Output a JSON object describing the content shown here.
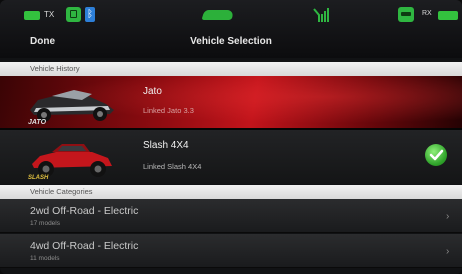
{
  "status_bar": {
    "tx_label": "TX",
    "rx_label": "RX",
    "icons": [
      "transmitter-battery-icon",
      "lock-icon",
      "bluetooth-icon",
      "vehicle-icon",
      "antenna-icon",
      "model-icon",
      "receiver-battery-icon"
    ]
  },
  "nav": {
    "done_label": "Done",
    "title": "Vehicle Selection"
  },
  "vehicle_history": {
    "header": "Vehicle History",
    "items": [
      {
        "name": "Jato",
        "subtitle": "Linked Jato 3.3",
        "selected": false
      },
      {
        "name": "Slash 4X4",
        "subtitle": "Linked Slash 4X4",
        "selected": true
      }
    ]
  },
  "vehicle_categories": {
    "header": "Vehicle Categories",
    "items": [
      {
        "title": "2wd Off-Road - Electric",
        "count": "17 models"
      },
      {
        "title": "4wd Off-Road - Electric",
        "count": "11 models"
      }
    ]
  },
  "colors": {
    "accent_green": "#33c23e",
    "row_red": "#c2141b",
    "header_light": "#e6e6e6"
  }
}
